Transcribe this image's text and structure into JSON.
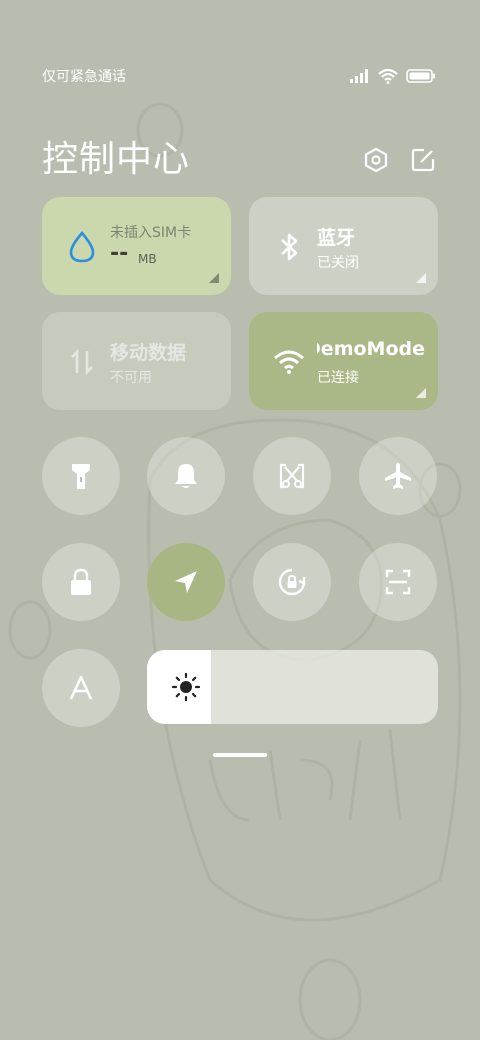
{
  "status_bar": {
    "carrier_text": "仅可紧急通话",
    "icons": [
      "signal-icon",
      "wifi-icon",
      "battery-icon"
    ]
  },
  "header": {
    "title": "控制中心",
    "settings_icon": "settings-hexagon-icon",
    "edit_icon": "edit-icon"
  },
  "tiles": {
    "sim": {
      "title": "未插入SIM卡",
      "value": "--",
      "unit": "MB",
      "icon": "water-drop-icon"
    },
    "bluetooth": {
      "title": "蓝牙",
      "status": "已关闭",
      "icon": "bluetooth-icon"
    },
    "mobile_data": {
      "title": "移动数据",
      "status": "不可用",
      "icon": "data-arrows-icon"
    },
    "wifi": {
      "title": "DemoMode",
      "status": "已连接",
      "icon": "wifi-icon"
    }
  },
  "toggles": {
    "row1": [
      "flashlight-icon",
      "bell-icon",
      "screenshot-scissors-icon",
      "airplane-icon"
    ],
    "row2": [
      "lock-icon",
      "location-arrow-icon",
      "rotation-lock-icon",
      "scan-icon"
    ],
    "row3": [
      "font-size-icon"
    ]
  },
  "brightness": {
    "level_percent": 22,
    "icon": "sun-icon"
  },
  "colors": {
    "background": "#b9bdb0",
    "sim_tile": "#cbd7ac",
    "wifi_tile": "#a9b886",
    "active_toggle": "#a8b684",
    "drop_blue": "#2b8fe0"
  }
}
